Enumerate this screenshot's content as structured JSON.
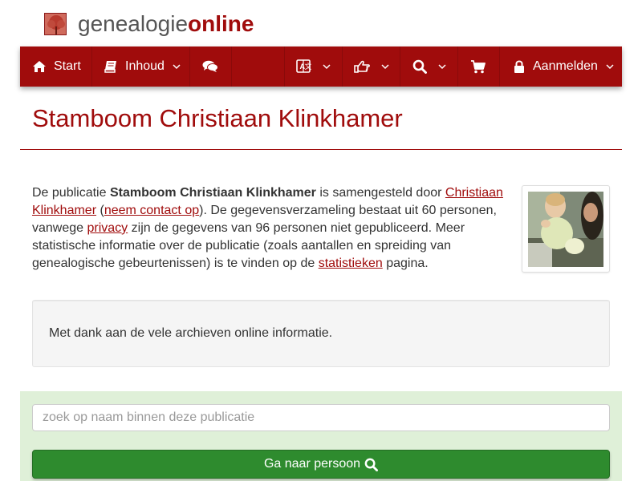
{
  "logo": {
    "icon": "tree-logo-icon",
    "part1": "genealogie",
    "part2": "online"
  },
  "nav": {
    "start_label": "Start",
    "start_icon": "home-icon",
    "inhoud_label": "Inhoud",
    "inhoud_icon": "book-icon",
    "chat_icon": "comments-icon",
    "language_icon": "language-icon",
    "share_icon": "hand-pointer-icon",
    "search_icon": "search-icon",
    "cart_icon": "shopping-cart-icon",
    "login_icon": "lock-icon",
    "login_label": "Aanmelden"
  },
  "page": {
    "title": "Stamboom Christiaan Klinkhamer"
  },
  "intro": {
    "p1": "De publicatie ",
    "pub_name": "Stamboom Christiaan Klinkhamer",
    "p2": " is samengesteld door ",
    "author_link": "Christiaan Klinkhamer",
    "p3": " (",
    "contact_link": "neem contact op",
    "p4": "). De gegevensverzameling bestaat uit 60 personen, vanwege ",
    "privacy_link": "privacy",
    "p5": " zijn de gegevens van 96 personen niet gepubliceerd. Meer statistische informatie over de publicatie (zoals aantallen en spreiding van genealogische gebeurtenissen) is te vinden op de ",
    "stats_link": "statistieken",
    "p6": " pagina."
  },
  "thanks": {
    "text": "Met dank aan de vele archieven online informatie."
  },
  "search": {
    "placeholder": "zoek op naam binnen deze publicatie",
    "button_label": "Ga naar persoon",
    "button_icon": "search-icon"
  },
  "colors": {
    "brand": "#a00c0c",
    "nav_bg": "#a00c0c",
    "search_bg": "#dff0d8",
    "button_green": "#2e8b2e"
  }
}
